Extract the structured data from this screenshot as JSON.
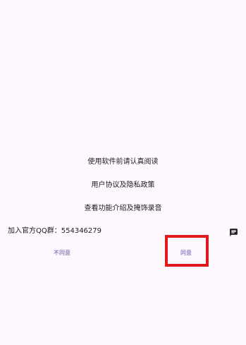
{
  "content": {
    "reminder": "使用软件前请认真阅读",
    "policy": "用户协议及隐私政策",
    "intro": "查看功能介绍及掩饰录音",
    "qq_group": "加入官方QQ群：554346279"
  },
  "icons": {
    "message": "message-icon"
  },
  "buttons": {
    "disagree": "不同意",
    "agree": "同意"
  },
  "colors": {
    "background": "#fdf8fd",
    "text": "#1c1b1f",
    "accent": "#6750a4",
    "highlight": "#e01a1a"
  }
}
